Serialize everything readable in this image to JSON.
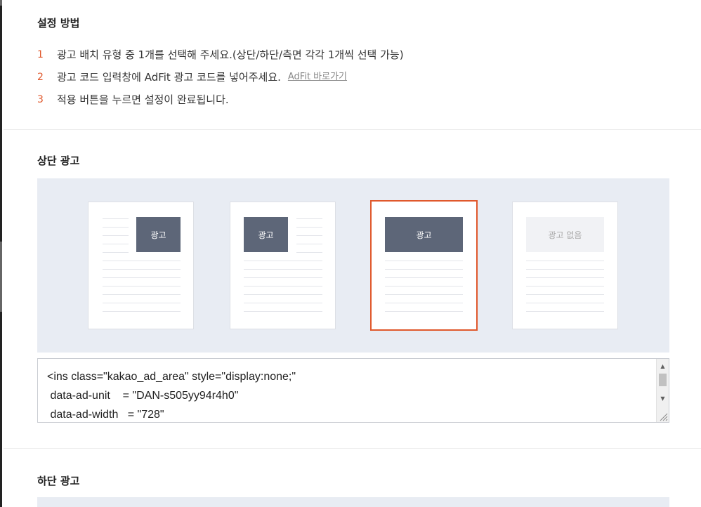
{
  "setup": {
    "title": "설정 방법",
    "steps": [
      {
        "num": "1",
        "text": "광고 배치 유형 중 1개를 선택해 주세요.(상단/하단/측면 각각 1개씩 선택 가능)"
      },
      {
        "num": "2",
        "text": "광고 코드 입력창에 AdFit 광고 코드를 넣어주세요.",
        "link": "AdFit 바로가기"
      },
      {
        "num": "3",
        "text": "적용 버튼을 누르면 설정이 완료됩니다."
      }
    ]
  },
  "top_ad": {
    "title": "상단 광고",
    "options": [
      {
        "label": "광고"
      },
      {
        "label": "광고"
      },
      {
        "label": "광고"
      },
      {
        "label": "광고 없음"
      }
    ],
    "selected_option": "광고 (center)",
    "code_lines": [
      "<ins class=\"kakao_ad_area\" style=\"display:none;\"",
      " data-ad-unit    = \"DAN-s505yy94r4h0\"",
      " data-ad-width   = \"728\""
    ]
  },
  "bottom_ad": {
    "title": "하단 광고"
  },
  "colors": {
    "accent": "#e0582c",
    "ad_block": "#5d6678",
    "panel_bg": "#e8ecf3"
  }
}
